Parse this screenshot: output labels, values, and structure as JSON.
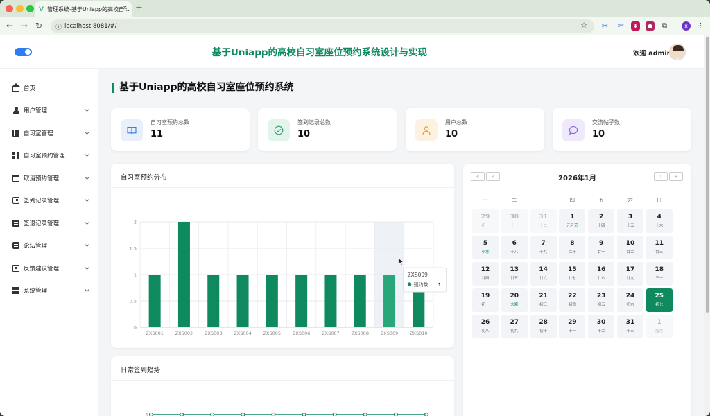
{
  "browser": {
    "tab_title": "管理系统-基于Uniapp的高校自...",
    "url": "localhost:8081/#/"
  },
  "header": {
    "title": "基于Uniapp的高校自习室座位预约系统设计与实现",
    "welcome": "欢迎 admin"
  },
  "sidebar": {
    "items": [
      {
        "label": "首页",
        "icon": "home-icon"
      },
      {
        "label": "用户管理",
        "icon": "user-icon"
      },
      {
        "label": "自习室管理",
        "icon": "book-icon"
      },
      {
        "label": "自习室预约管理",
        "icon": "grid-icon"
      },
      {
        "label": "取消预约管理",
        "icon": "calendar-icon"
      },
      {
        "label": "签到记录管理",
        "icon": "wallet-icon"
      },
      {
        "label": "签退记录管理",
        "icon": "list-icon"
      },
      {
        "label": "论坛管理",
        "icon": "chat-icon"
      },
      {
        "label": "反馈建议管理",
        "icon": "doc-icon"
      },
      {
        "label": "系统管理",
        "icon": "settings-icon"
      }
    ]
  },
  "main": {
    "page_title": "基于Uniapp的高校自习室座位预约系统",
    "stats": [
      {
        "label": "自习室预约总数",
        "value": "11",
        "icon": "book-open-icon",
        "color": "#3a7bd5",
        "bg": "#e7f0fc"
      },
      {
        "label": "签到记录总数",
        "value": "10",
        "icon": "check-circle-icon",
        "color": "#2e9e6b",
        "bg": "#e3f4ec"
      },
      {
        "label": "用户总数",
        "value": "10",
        "icon": "user-icon",
        "color": "#e79a2c",
        "bg": "#fdf1e1"
      },
      {
        "label": "交流帖子数",
        "value": "10",
        "icon": "message-icon",
        "color": "#8a5fe0",
        "bg": "#efe9fc"
      }
    ],
    "bar_card_title": "自习室预约分布",
    "trend_card_title": "日常签到趋势",
    "tooltip": {
      "title": "ZXS009",
      "series": "预约数",
      "value": "1"
    }
  },
  "chart_data": [
    {
      "type": "bar",
      "title": "自习室预约分布",
      "categories": [
        "ZXS001",
        "ZXS002",
        "ZXS003",
        "ZXS004",
        "ZXS005",
        "ZXS006",
        "ZXS007",
        "ZXS008",
        "ZXS009",
        "ZXS010"
      ],
      "series": [
        {
          "name": "预约数",
          "values": [
            1,
            2,
            1,
            1,
            1,
            1,
            1,
            1,
            1,
            1
          ]
        }
      ],
      "ylim": [
        0,
        2
      ],
      "yticks": [
        "0",
        "0.5",
        "1",
        "1.5",
        "2"
      ],
      "grid": true,
      "highlighted_category": "ZXS009",
      "color": "#0f8a5f",
      "highlight_color": "#27a77a"
    },
    {
      "type": "line",
      "title": "日常签到趋势",
      "ytick_visible": "1",
      "points_visible": 10,
      "values": [
        1,
        1,
        1,
        1,
        1,
        1,
        1,
        1,
        1,
        1
      ],
      "color": "#0f8a5f"
    }
  ],
  "calendar": {
    "month_label": "2026年1月",
    "weekdays": [
      "一",
      "二",
      "三",
      "四",
      "五",
      "六",
      "日"
    ],
    "days": [
      {
        "d": "29",
        "l": "初十",
        "other": true
      },
      {
        "d": "30",
        "l": "十一",
        "other": true
      },
      {
        "d": "31",
        "l": "十二",
        "other": true
      },
      {
        "d": "1",
        "l": "元旦节",
        "hol": true
      },
      {
        "d": "2",
        "l": "十四"
      },
      {
        "d": "3",
        "l": "十五"
      },
      {
        "d": "4",
        "l": "十六"
      },
      {
        "d": "5",
        "l": "小寒",
        "hol": true
      },
      {
        "d": "6",
        "l": "十八"
      },
      {
        "d": "7",
        "l": "十九"
      },
      {
        "d": "8",
        "l": "二十"
      },
      {
        "d": "9",
        "l": "廿一"
      },
      {
        "d": "10",
        "l": "廿二"
      },
      {
        "d": "11",
        "l": "廿三"
      },
      {
        "d": "12",
        "l": "廿四"
      },
      {
        "d": "13",
        "l": "廿五"
      },
      {
        "d": "14",
        "l": "廿六"
      },
      {
        "d": "15",
        "l": "廿七"
      },
      {
        "d": "16",
        "l": "廿八"
      },
      {
        "d": "17",
        "l": "廿九"
      },
      {
        "d": "18",
        "l": "三十"
      },
      {
        "d": "19",
        "l": "初一"
      },
      {
        "d": "20",
        "l": "大寒",
        "hol": true
      },
      {
        "d": "21",
        "l": "初三"
      },
      {
        "d": "22",
        "l": "初四"
      },
      {
        "d": "23",
        "l": "初五"
      },
      {
        "d": "24",
        "l": "初六"
      },
      {
        "d": "25",
        "l": "初七",
        "today": true
      },
      {
        "d": "26",
        "l": "初八"
      },
      {
        "d": "27",
        "l": "初九"
      },
      {
        "d": "28",
        "l": "初十"
      },
      {
        "d": "29",
        "l": "十一"
      },
      {
        "d": "30",
        "l": "十二"
      },
      {
        "d": "31",
        "l": "十三"
      },
      {
        "d": "1",
        "l": "腊月",
        "other": true
      }
    ]
  }
}
